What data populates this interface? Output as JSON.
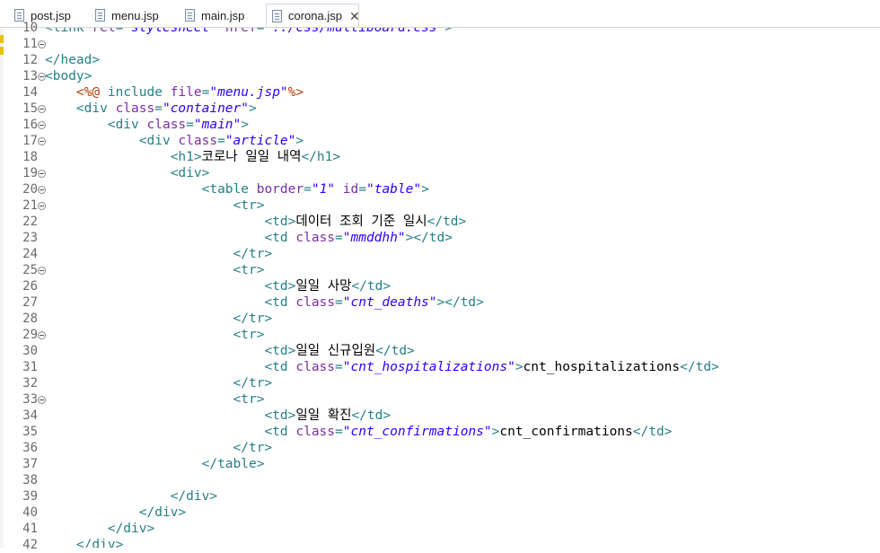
{
  "tabs": [
    {
      "label": "post.jsp",
      "active": false
    },
    {
      "label": "menu.jsp",
      "active": false
    },
    {
      "label": "main.jsp",
      "active": false
    },
    {
      "label": "corona.jsp",
      "active": true
    }
  ],
  "tab_close_glyph": "✕",
  "editor": {
    "lines": [
      {
        "num": "10",
        "fold": false,
        "segments": [
          {
            "t": "tag",
            "v": "<link "
          },
          {
            "t": "att",
            "v": "rel"
          },
          {
            "t": "tag",
            "v": "="
          },
          {
            "t": "val",
            "v": "\"stylesheet\" "
          },
          {
            "t": "att",
            "v": "href"
          },
          {
            "t": "tag",
            "v": "="
          },
          {
            "t": "val",
            "v": "\"../css/multiboard.css\""
          },
          {
            "t": "tag",
            "v": ">"
          }
        ]
      },
      {
        "num": "11",
        "fold": true,
        "segments": []
      },
      {
        "num": "12",
        "fold": false,
        "segments": [
          {
            "t": "tag",
            "v": "</head>"
          }
        ]
      },
      {
        "num": "13",
        "fold": true,
        "segments": [
          {
            "t": "tag",
            "v": "<body>"
          }
        ]
      },
      {
        "num": "14",
        "fold": false,
        "segments": [
          {
            "t": "txt",
            "v": "    "
          },
          {
            "t": "dir",
            "v": "<%@"
          },
          {
            "t": "tag",
            "v": " include "
          },
          {
            "t": "att",
            "v": "file"
          },
          {
            "t": "tag",
            "v": "="
          },
          {
            "t": "val",
            "v": "\"menu.jsp\""
          },
          {
            "t": "dir",
            "v": "%>"
          }
        ]
      },
      {
        "num": "15",
        "fold": true,
        "segments": [
          {
            "t": "txt",
            "v": "    "
          },
          {
            "t": "tag",
            "v": "<div "
          },
          {
            "t": "att",
            "v": "class"
          },
          {
            "t": "tag",
            "v": "="
          },
          {
            "t": "val",
            "v": "\"container\""
          },
          {
            "t": "tag",
            "v": ">"
          }
        ]
      },
      {
        "num": "16",
        "fold": true,
        "segments": [
          {
            "t": "txt",
            "v": "        "
          },
          {
            "t": "tag",
            "v": "<div "
          },
          {
            "t": "att",
            "v": "class"
          },
          {
            "t": "tag",
            "v": "="
          },
          {
            "t": "val",
            "v": "\"main\""
          },
          {
            "t": "tag",
            "v": ">"
          }
        ]
      },
      {
        "num": "17",
        "fold": true,
        "segments": [
          {
            "t": "txt",
            "v": "            "
          },
          {
            "t": "tag",
            "v": "<div "
          },
          {
            "t": "att",
            "v": "class"
          },
          {
            "t": "tag",
            "v": "="
          },
          {
            "t": "val",
            "v": "\"article\""
          },
          {
            "t": "tag",
            "v": ">"
          }
        ]
      },
      {
        "num": "18",
        "fold": false,
        "segments": [
          {
            "t": "txt",
            "v": "                "
          },
          {
            "t": "tag",
            "v": "<h1>"
          },
          {
            "t": "txt",
            "v": "코로나 일일 내역"
          },
          {
            "t": "tag",
            "v": "</h1>"
          }
        ]
      },
      {
        "num": "19",
        "fold": true,
        "segments": [
          {
            "t": "txt",
            "v": "                "
          },
          {
            "t": "tag",
            "v": "<div>"
          }
        ]
      },
      {
        "num": "20",
        "fold": true,
        "segments": [
          {
            "t": "txt",
            "v": "                    "
          },
          {
            "t": "tag",
            "v": "<table "
          },
          {
            "t": "att",
            "v": "border"
          },
          {
            "t": "tag",
            "v": "="
          },
          {
            "t": "val",
            "v": "\"1\""
          },
          {
            "t": "tag",
            "v": " "
          },
          {
            "t": "att",
            "v": "id"
          },
          {
            "t": "tag",
            "v": "="
          },
          {
            "t": "val",
            "v": "\"table\""
          },
          {
            "t": "tag",
            "v": ">"
          }
        ]
      },
      {
        "num": "21",
        "fold": true,
        "segments": [
          {
            "t": "txt",
            "v": "                        "
          },
          {
            "t": "tag",
            "v": "<tr>"
          }
        ]
      },
      {
        "num": "22",
        "fold": false,
        "segments": [
          {
            "t": "txt",
            "v": "                            "
          },
          {
            "t": "tag",
            "v": "<td>"
          },
          {
            "t": "txt",
            "v": "데이터 조회 기준 일시"
          },
          {
            "t": "tag",
            "v": "</td>"
          }
        ]
      },
      {
        "num": "23",
        "fold": false,
        "segments": [
          {
            "t": "txt",
            "v": "                            "
          },
          {
            "t": "tag",
            "v": "<td "
          },
          {
            "t": "att",
            "v": "class"
          },
          {
            "t": "tag",
            "v": "="
          },
          {
            "t": "val",
            "v": "\"mmddhh\""
          },
          {
            "t": "tag",
            "v": "></td>"
          }
        ]
      },
      {
        "num": "24",
        "fold": false,
        "segments": [
          {
            "t": "txt",
            "v": "                        "
          },
          {
            "t": "tag",
            "v": "</tr>"
          }
        ]
      },
      {
        "num": "25",
        "fold": true,
        "segments": [
          {
            "t": "txt",
            "v": "                        "
          },
          {
            "t": "tag",
            "v": "<tr>"
          }
        ]
      },
      {
        "num": "26",
        "fold": false,
        "segments": [
          {
            "t": "txt",
            "v": "                            "
          },
          {
            "t": "tag",
            "v": "<td>"
          },
          {
            "t": "txt",
            "v": "일일 사망"
          },
          {
            "t": "tag",
            "v": "</td>"
          }
        ]
      },
      {
        "num": "27",
        "fold": false,
        "segments": [
          {
            "t": "txt",
            "v": "                            "
          },
          {
            "t": "tag",
            "v": "<td "
          },
          {
            "t": "att",
            "v": "class"
          },
          {
            "t": "tag",
            "v": "="
          },
          {
            "t": "val",
            "v": "\"cnt_deaths\""
          },
          {
            "t": "tag",
            "v": "></td>"
          }
        ]
      },
      {
        "num": "28",
        "fold": false,
        "segments": [
          {
            "t": "txt",
            "v": "                        "
          },
          {
            "t": "tag",
            "v": "</tr>"
          }
        ]
      },
      {
        "num": "29",
        "fold": true,
        "segments": [
          {
            "t": "txt",
            "v": "                        "
          },
          {
            "t": "tag",
            "v": "<tr>"
          }
        ]
      },
      {
        "num": "30",
        "fold": false,
        "segments": [
          {
            "t": "txt",
            "v": "                            "
          },
          {
            "t": "tag",
            "v": "<td>"
          },
          {
            "t": "txt",
            "v": "일일 신규입원"
          },
          {
            "t": "tag",
            "v": "</td>"
          }
        ]
      },
      {
        "num": "31",
        "fold": false,
        "segments": [
          {
            "t": "txt",
            "v": "                            "
          },
          {
            "t": "tag",
            "v": "<td "
          },
          {
            "t": "att",
            "v": "class"
          },
          {
            "t": "tag",
            "v": "="
          },
          {
            "t": "val",
            "v": "\"cnt_hospitalizations\""
          },
          {
            "t": "tag",
            "v": ">"
          },
          {
            "t": "txt",
            "v": "cnt_hospitalizations"
          },
          {
            "t": "tag",
            "v": "</td>"
          }
        ]
      },
      {
        "num": "32",
        "fold": false,
        "segments": [
          {
            "t": "txt",
            "v": "                        "
          },
          {
            "t": "tag",
            "v": "</tr>"
          }
        ]
      },
      {
        "num": "33",
        "fold": true,
        "segments": [
          {
            "t": "txt",
            "v": "                        "
          },
          {
            "t": "tag",
            "v": "<tr>"
          }
        ]
      },
      {
        "num": "34",
        "fold": false,
        "segments": [
          {
            "t": "txt",
            "v": "                            "
          },
          {
            "t": "tag",
            "v": "<td>"
          },
          {
            "t": "txt",
            "v": "일일 확진"
          },
          {
            "t": "tag",
            "v": "</td>"
          }
        ]
      },
      {
        "num": "35",
        "fold": false,
        "segments": [
          {
            "t": "txt",
            "v": "                            "
          },
          {
            "t": "tag",
            "v": "<td "
          },
          {
            "t": "att",
            "v": "class"
          },
          {
            "t": "tag",
            "v": "="
          },
          {
            "t": "val",
            "v": "\"cnt_confirmations\""
          },
          {
            "t": "tag",
            "v": ">"
          },
          {
            "t": "txt",
            "v": "cnt_confirmations"
          },
          {
            "t": "tag",
            "v": "</td>"
          }
        ]
      },
      {
        "num": "36",
        "fold": false,
        "segments": [
          {
            "t": "txt",
            "v": "                        "
          },
          {
            "t": "tag",
            "v": "</tr>"
          }
        ]
      },
      {
        "num": "37",
        "fold": false,
        "segments": [
          {
            "t": "txt",
            "v": "                    "
          },
          {
            "t": "tag",
            "v": "</table>"
          }
        ]
      },
      {
        "num": "38",
        "fold": false,
        "segments": []
      },
      {
        "num": "39",
        "fold": false,
        "segments": [
          {
            "t": "txt",
            "v": "                "
          },
          {
            "t": "tag",
            "v": "</div>"
          }
        ]
      },
      {
        "num": "40",
        "fold": false,
        "segments": [
          {
            "t": "txt",
            "v": "            "
          },
          {
            "t": "tag",
            "v": "</div>"
          }
        ]
      },
      {
        "num": "41",
        "fold": false,
        "segments": [
          {
            "t": "txt",
            "v": "        "
          },
          {
            "t": "tag",
            "v": "</div>"
          }
        ]
      },
      {
        "num": "42",
        "fold": false,
        "segments": [
          {
            "t": "txt",
            "v": "    "
          },
          {
            "t": "tag",
            "v": "</div>"
          }
        ]
      }
    ]
  }
}
